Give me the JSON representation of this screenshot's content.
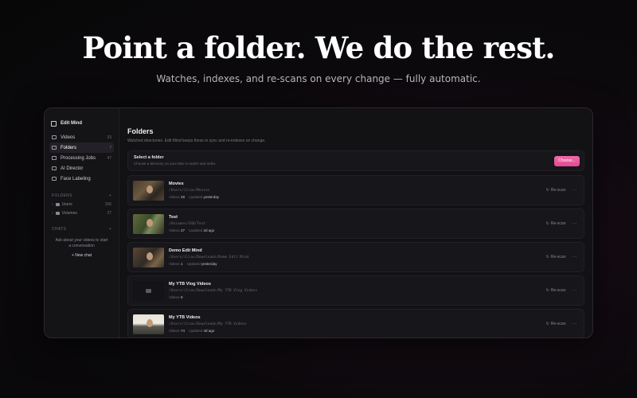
{
  "hero": {
    "title": "Point a folder. We do the rest.",
    "subtitle": "Watches, indexes, and re-scans on every change — fully automatic."
  },
  "sidebar": {
    "brand": "Edit Mind",
    "nav": [
      {
        "label": "Videos",
        "count": "33",
        "icon": "video-icon"
      },
      {
        "label": "Folders",
        "count": "7",
        "icon": "folder-icon",
        "active": true
      },
      {
        "label": "Processing Jobs",
        "count": "47",
        "icon": "list-icon"
      },
      {
        "label": "AI Director",
        "count": "",
        "icon": "sparkle-icon"
      },
      {
        "label": "Face Labeling",
        "count": "",
        "icon": "face-icon"
      }
    ],
    "folders_header": "FOLDERS",
    "folders_add": "+",
    "folder_tree": [
      {
        "label": "Users",
        "count": "156"
      },
      {
        "label": "Volumes",
        "count": "27"
      }
    ],
    "chats_header": "CHATS",
    "chats_add": "+",
    "chats_hint": "Ask about your videos to start a conversation",
    "new_chat": "+ New chat"
  },
  "main": {
    "title": "Folders",
    "description": "Watched directories. Edit Mind keeps these in sync and re-indexes on change.",
    "select": {
      "title": "Select a folder",
      "description": "Choose a directory on your Mac to watch and index.",
      "button": "Choose..."
    },
    "videos_label": "Videos",
    "updated_label": "Updated",
    "rescan_label": "Re-scan",
    "more_label": "···",
    "folders": [
      {
        "name": "Movies",
        "path": "/Users/ilias/Movies",
        "videos": "28",
        "updated": "yesterday",
        "thumb": "v1"
      },
      {
        "name": "Test",
        "path": "/Volumes/SSD/Test",
        "videos": "27",
        "updated": "2d ago",
        "thumb": "v2"
      },
      {
        "name": "Demo Edit Mind",
        "path": "/Users/ilias/Downloads/Demo Edit Mind",
        "videos": "1",
        "updated": "yesterday",
        "thumb": "v3"
      },
      {
        "name": "My YTB Vlog Videos",
        "path": "/Users/ilias/Downloads/My YTB Vlog Videos",
        "videos": "9",
        "updated": "",
        "thumb": "empty"
      },
      {
        "name": "My YTB Videos",
        "path": "/Users/ilias/Downloads/My YTB Videos",
        "videos": "74",
        "updated": "4d ago",
        "thumb": "v5"
      }
    ]
  }
}
